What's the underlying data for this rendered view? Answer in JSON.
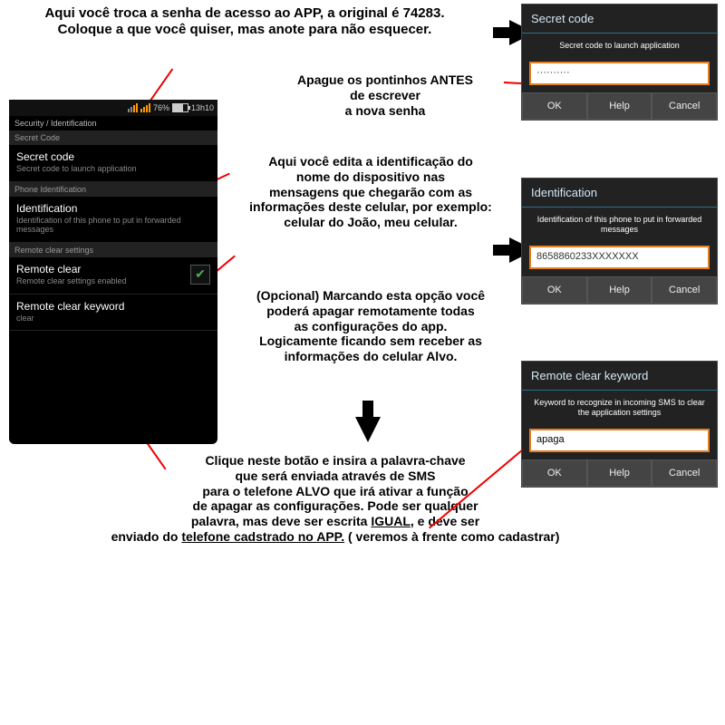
{
  "note_top": "Aqui você troca a senha de acesso ao APP, a original é 74283.\nColoque a que você quiser, mas anote para não esquecer.",
  "note_erase": "Apague os pontinhos ANTES\nde escrever\na nova senha",
  "note_ident": "Aqui você edita a identificação do\nnome do dispositivo nas\nmensagens que chegarão com as\ninformações deste celular, por exemplo:\ncelular do João, meu celular.",
  "note_remote": "(Opcional) Marcando esta opção você\npoderá apagar remotamente todas\nas configurações do app.\nLogicamente ficando sem receber as\ninformações do celular Alvo.",
  "note_keyword_a": "Clique neste botão e insira a palavra-chave\nque será enviada através de SMS\npara o telefone ALVO que irá ativar a função\nde apagar as configurações. Pode ser qualquer\npalavra, mas deve ser escrita ",
  "note_keyword_b": "IGUAL",
  "note_keyword_c": ", e deve ser\nenviado do ",
  "note_keyword_d": "telefone cadstrado no APP.",
  "note_keyword_e": " ( veremos à frente como cadastrar)",
  "phone": {
    "status_pct": "76%",
    "status_time": "13h10",
    "crumb": "Security / Identification",
    "sect1": "Secret Code",
    "r1_t": "Secret code",
    "r1_s": "Secret code to launch application",
    "sect2": "Phone Identification",
    "r2_t": "Identification",
    "r2_s": "Identification of this phone to put in forwarded messages",
    "sect3": "Remote clear settings",
    "r3_t": "Remote clear",
    "r3_s": "Remote clear settings enabled",
    "r4_t": "Remote clear keyword",
    "r4_s": "clear"
  },
  "d1": {
    "title": "Secret code",
    "sub": "Secret code to launch application",
    "val": "··········"
  },
  "d2": {
    "title": "Identification",
    "sub": "Identification of this phone to put in forwarded messages",
    "val": "8658860233XXXXXXX"
  },
  "d3": {
    "title": "Remote clear keyword",
    "sub": "Keyword to recognize in incoming SMS to clear the application settings",
    "val": "apaga"
  },
  "btns": {
    "ok": "OK",
    "help": "Help",
    "cancel": "Cancel"
  }
}
